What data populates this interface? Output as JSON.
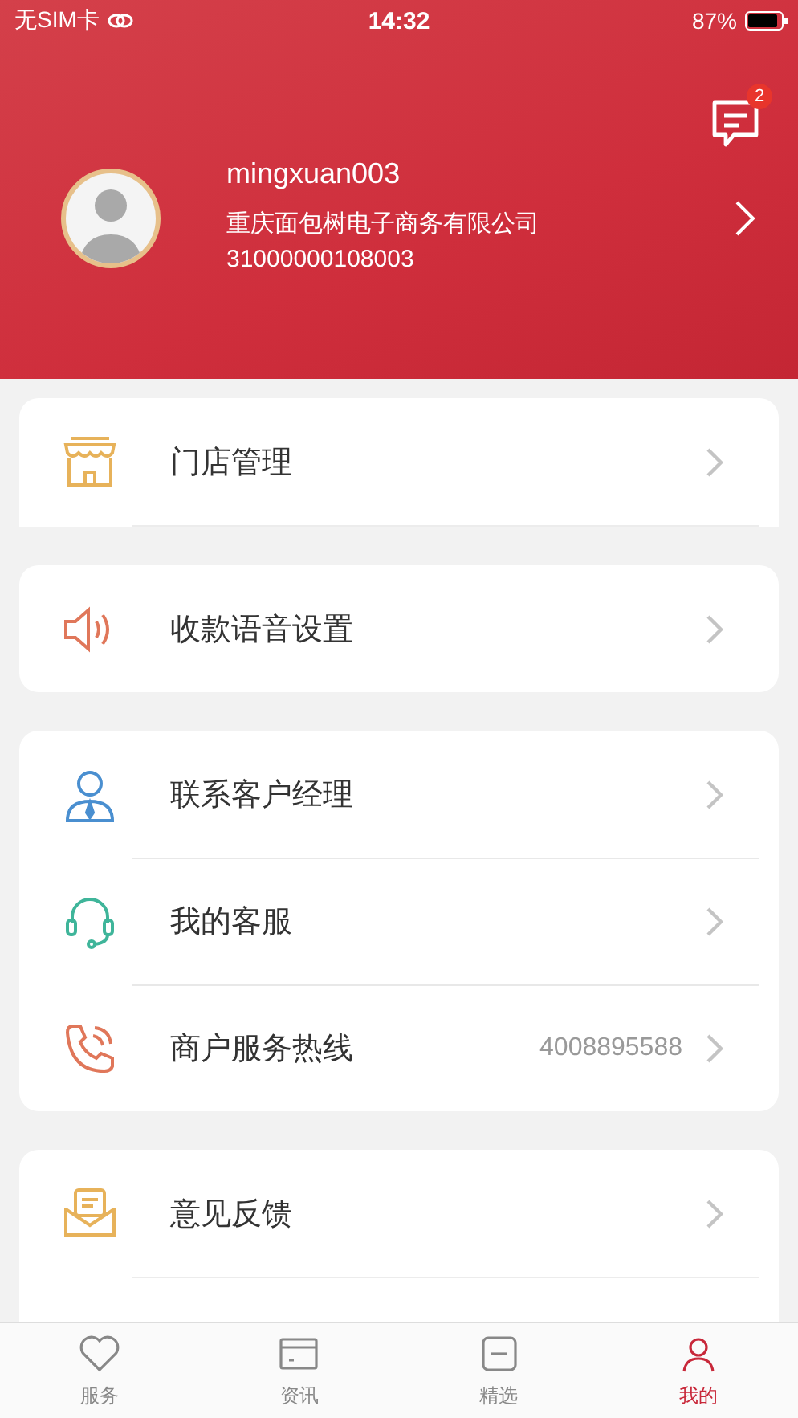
{
  "status_bar": {
    "carrier": "无SIM卡",
    "time": "14:32",
    "battery": "87%"
  },
  "header": {
    "messages_badge": "2",
    "username": "mingxuan003",
    "company": "重庆面包树电子商务有限公司",
    "merchant_id": "31000000108003"
  },
  "sections": [
    {
      "items": [
        {
          "label": "门店管理"
        }
      ],
      "cut": true
    },
    {
      "items": [
        {
          "label": "收款语音设置"
        }
      ],
      "cut": false
    },
    {
      "items": [
        {
          "label": "联系客户经理"
        },
        {
          "label": "我的客服"
        },
        {
          "label": "商户服务热线",
          "value": "4008895588"
        }
      ],
      "cut": false
    },
    {
      "items": [
        {
          "label": "意见反馈"
        }
      ],
      "cut": true
    }
  ],
  "tab_bar": [
    {
      "label": "服务",
      "selected": false
    },
    {
      "label": "资讯",
      "selected": false
    },
    {
      "label": "精选",
      "selected": false
    },
    {
      "label": "我的",
      "selected": true
    }
  ]
}
